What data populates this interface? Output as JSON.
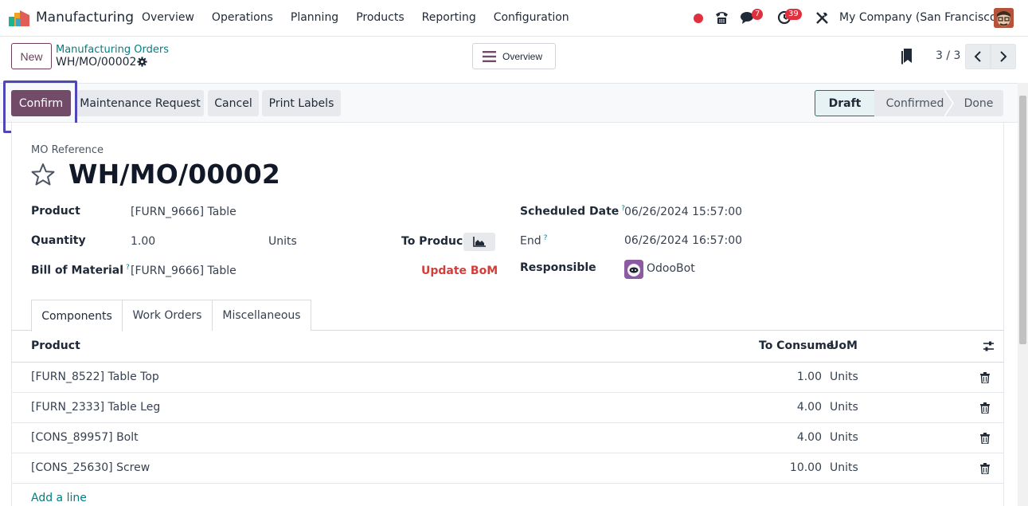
{
  "navbar": {
    "app_name": "Manufacturing",
    "menu": [
      "Overview",
      "Operations",
      "Planning",
      "Products",
      "Reporting",
      "Configuration"
    ],
    "messages_count": "7",
    "activities_count": "39",
    "company": "My Company (San Francisco)"
  },
  "control_panel": {
    "new_label": "New",
    "breadcrumb_parent": "Manufacturing Orders",
    "breadcrumb_current": "WH/MO/00002",
    "overview_label": "Overview",
    "pager": "3 / 3"
  },
  "actions": {
    "confirm": "Confirm",
    "maintenance": "Maintenance Request",
    "cancel": "Cancel",
    "print_labels": "Print Labels"
  },
  "status": {
    "stages": [
      "Draft",
      "Confirmed",
      "Done"
    ],
    "current": "Draft"
  },
  "form": {
    "ref_label": "MO Reference",
    "title": "WH/MO/00002",
    "product_label": "Product",
    "product_value": "[FURN_9666] Table",
    "quantity_label": "Quantity",
    "quantity_value": "1.00",
    "quantity_uom": "Units",
    "to_produce_label": "To Produce",
    "bom_label": "Bill of Material",
    "bom_value": "[FURN_9666] Table",
    "update_bom": "Update BoM",
    "scheduled_label": "Scheduled Date",
    "scheduled_value": "06/26/2024 15:57:00",
    "end_label": "End",
    "end_value": "06/26/2024 16:57:00",
    "responsible_label": "Responsible",
    "responsible_value": "OdooBot",
    "help_mark": "?"
  },
  "tabs": [
    "Components",
    "Work Orders",
    "Miscellaneous"
  ],
  "components": {
    "headers": {
      "product": "Product",
      "to_consume": "To Consume",
      "uom": "UoM"
    },
    "rows": [
      {
        "product": "[FURN_8522] Table Top",
        "qty": "1.00",
        "uom": "Units"
      },
      {
        "product": "[FURN_2333] Table Leg",
        "qty": "4.00",
        "uom": "Units"
      },
      {
        "product": "[CONS_89957] Bolt",
        "qty": "4.00",
        "uom": "Units"
      },
      {
        "product": "[CONS_25630] Screw",
        "qty": "10.00",
        "uom": "Units"
      }
    ],
    "add_line": "Add a line"
  },
  "colors": {
    "brand": "#714b67",
    "link": "#017e84",
    "danger": "#d23f3a",
    "focus_ring": "#4f46b8"
  }
}
